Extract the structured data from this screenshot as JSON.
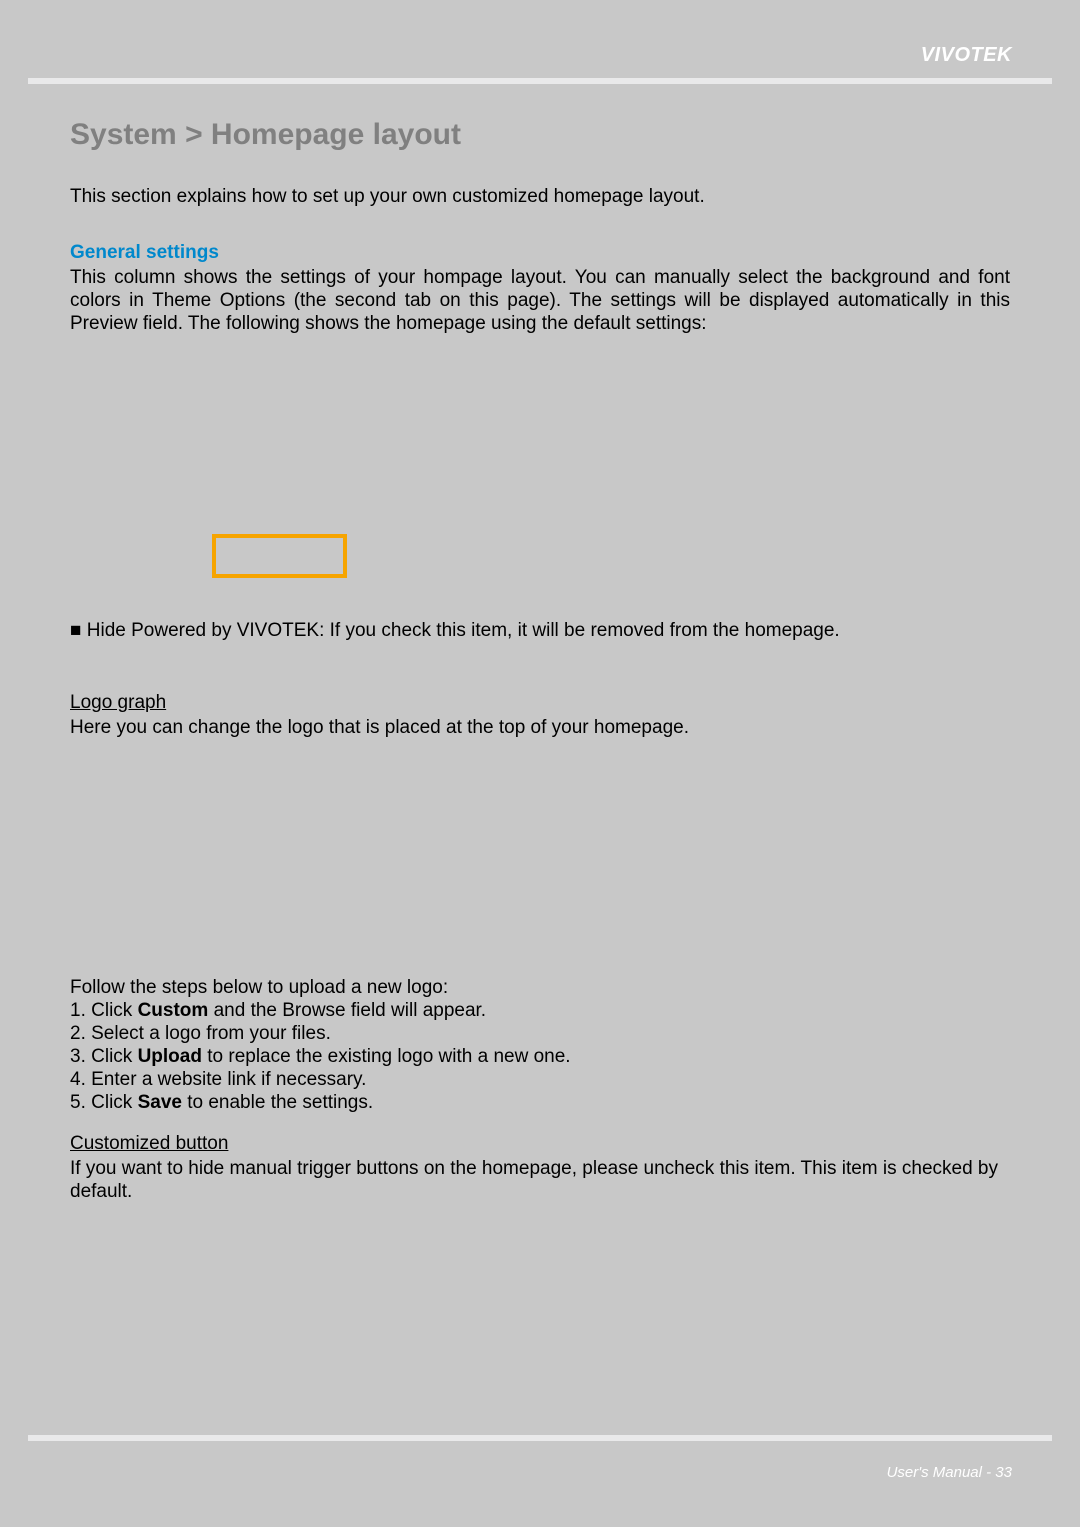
{
  "brand": "VIVOTEK",
  "title": "System > Homepage layout",
  "intro": "This section explains how to set up your own customized homepage layout.",
  "general": {
    "heading": "General settings",
    "body": "This column shows the settings of your hompage layout. You can manually select the background and font colors in Theme Options (the second tab on this page). The settings will be displayed automatically in this Preview field. The following shows the homepage using the default settings:"
  },
  "bulletLine": "■ Hide Powered by VIVOTEK: If you check this item, it will be removed from the homepage.",
  "logoGraph": {
    "heading": "Logo graph",
    "body": "Here you can change the logo that is placed at the top of your homepage."
  },
  "stepsIntro": "Follow the steps below to upload a new logo:",
  "steps": [
    {
      "prefix": "1. Click ",
      "bold": "Custom",
      "suffix": " and the Browse field will appear."
    },
    {
      "prefix": "2. Select a logo from your files.",
      "bold": "",
      "suffix": ""
    },
    {
      "prefix": "3. Click ",
      "bold": "Upload",
      "suffix": " to replace the existing logo with a new one."
    },
    {
      "prefix": "4. Enter a website link if necessary.",
      "bold": "",
      "suffix": ""
    },
    {
      "prefix": "5. Click ",
      "bold": "Save",
      "suffix": " to enable the settings."
    }
  ],
  "customizedButton": {
    "heading": "Customized button",
    "body": "If you want to hide manual trigger buttons on the homepage, please uncheck this item. This item is checked by default."
  },
  "footer": "User's Manual - 33"
}
